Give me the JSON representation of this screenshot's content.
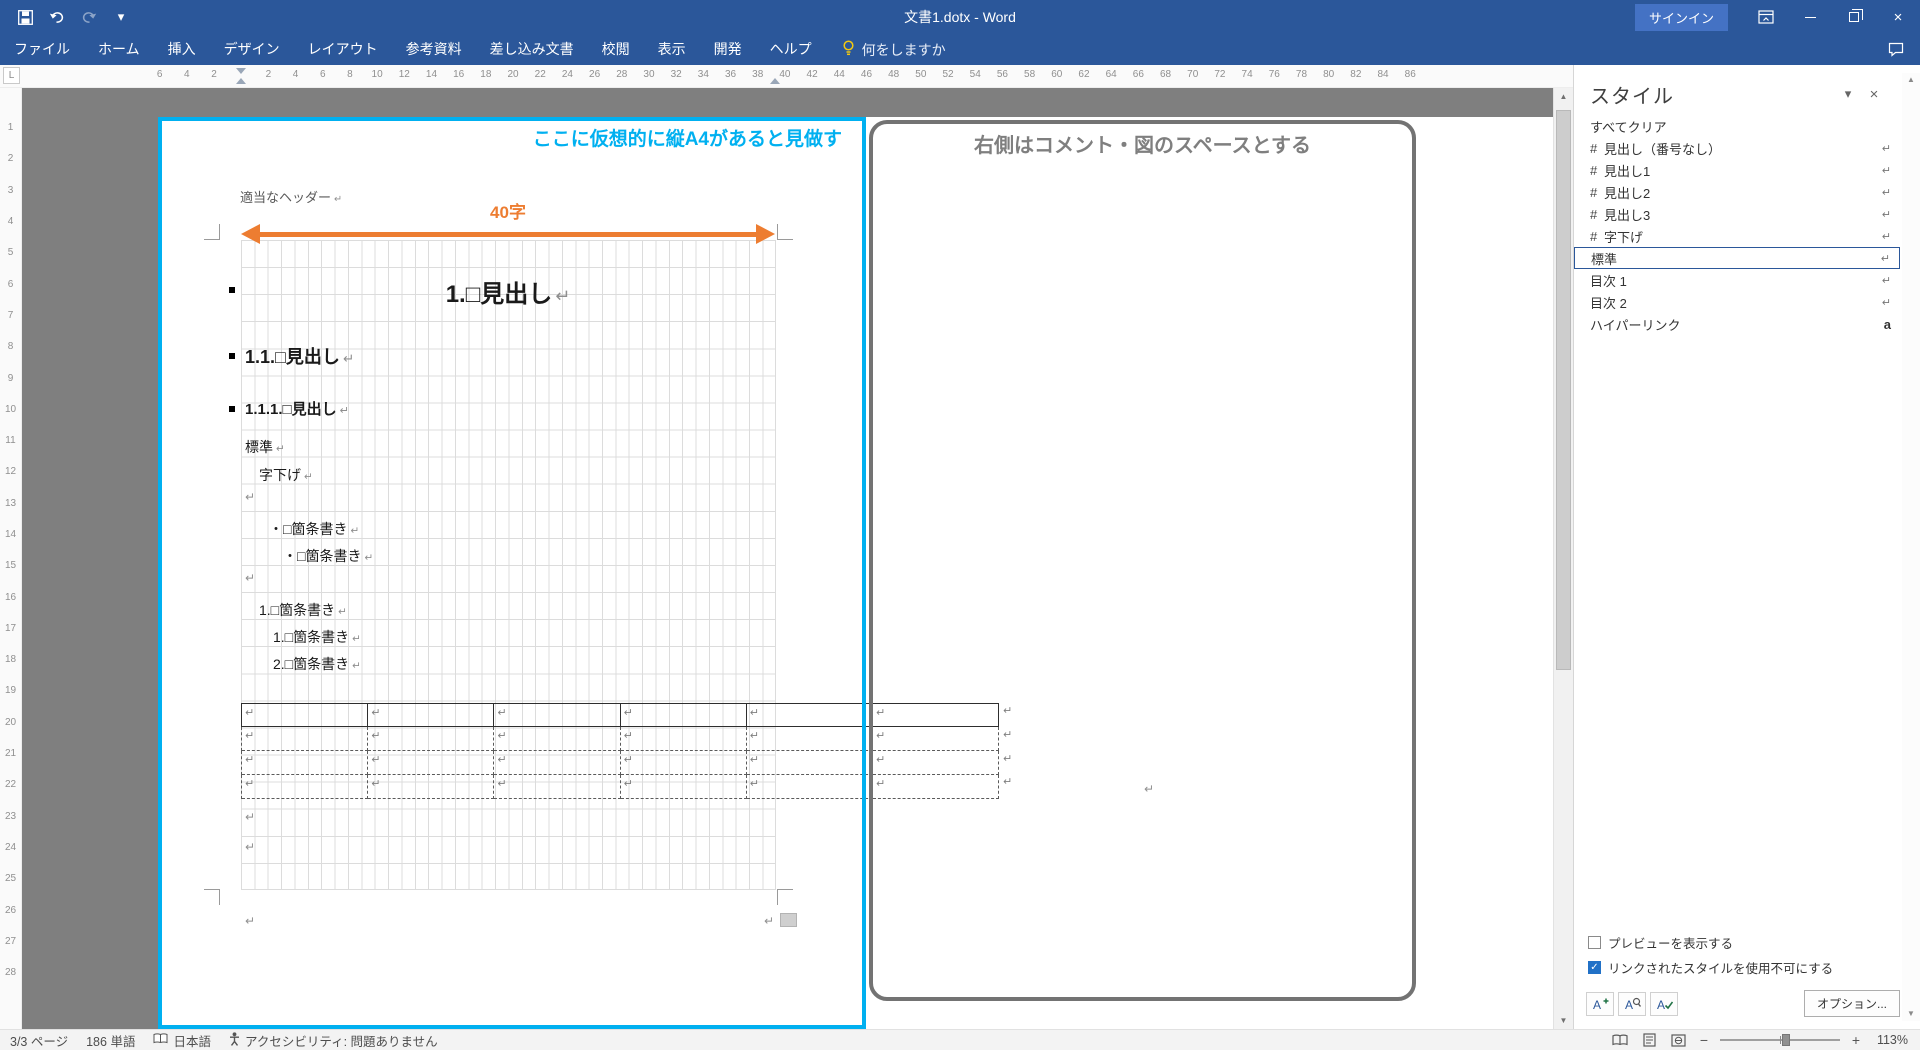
{
  "colors": {
    "titlebar_blue": "#2b579a",
    "virtual_a4_frame_cyan": "#00b0f0",
    "arrow_orange": "#ed7d31",
    "selection_blue": "#2b579a",
    "checkbox_blue": "#2171c7"
  },
  "window": {
    "title": "文書1.dotx - Word",
    "signin": "サインイン"
  },
  "icons": {
    "tab_l": "L",
    "caret": "▾",
    "chevron_down": "▾",
    "close": "×",
    "minimize": "─",
    "scroll_up": "▲",
    "scroll_down": "▼",
    "check": "✓",
    "zoom_minus": "−",
    "zoom_plus": "+"
  },
  "ribbon": {
    "tabs": [
      "ファイル",
      "ホーム",
      "挿入",
      "デザイン",
      "レイアウト",
      "参考資料",
      "差し込み文書",
      "校閲",
      "表示",
      "開発",
      "ヘルプ"
    ],
    "tell_me": "何をしますか"
  },
  "ruler": {
    "h": [
      "6",
      "4",
      "2",
      "",
      "2",
      "4",
      "6",
      "8",
      "10",
      "12",
      "14",
      "16",
      "18",
      "20",
      "22",
      "24",
      "26",
      "28",
      "30",
      "32",
      "34",
      "36",
      "38",
      "40",
      "42",
      "44",
      "46",
      "48",
      "50",
      "52",
      "54",
      "56",
      "58",
      "60",
      "62",
      "64",
      "66",
      "68",
      "70",
      "72",
      "74",
      "76",
      "78",
      "80",
      "82",
      "84",
      "86"
    ],
    "v": [
      "1",
      "2",
      "3",
      "4",
      "5",
      "6",
      "7",
      "8",
      "9",
      "10",
      "11",
      "12",
      "13",
      "14",
      "15",
      "16",
      "17",
      "18",
      "19",
      "20",
      "21",
      "22",
      "23",
      "24",
      "25",
      "26",
      "27",
      "28"
    ]
  },
  "marks": {
    "ret": "↵"
  },
  "doc": {
    "note_left": "ここに仮想的に縦A4があると見做す",
    "note_right": "右側はコメント・図のスペースとする",
    "header": "適当なヘッダー",
    "width_label": "40字",
    "h1": "1.□見出し",
    "h2": "1.1.□見出し",
    "h3": "1.1.1.□見出し",
    "normal": "標準",
    "indent": "字下げ",
    "b1": "・□箇条書き",
    "b2": "・□箇条書き",
    "n1": "1.□箇条書き",
    "n2": "1.□箇条書き",
    "n3": "2.□箇条書き"
  },
  "table": {
    "row_marks": [
      "↵",
      "↵",
      "↵",
      "↵",
      "↵",
      "↵"
    ],
    "out_marks": [
      "↵",
      "↵",
      "↵",
      "↵"
    ]
  },
  "styles": {
    "title": "スタイル",
    "clear_all": "すべてクリア",
    "items": [
      {
        "prefix": "",
        "label": "すべてクリア",
        "marker": ""
      },
      {
        "prefix": "#",
        "label": "見出し（番号なし）",
        "marker": "↵"
      },
      {
        "prefix": "#",
        "label": "見出し1",
        "marker": "↵"
      },
      {
        "prefix": "#",
        "label": "見出し2",
        "marker": "↵"
      },
      {
        "prefix": "#",
        "label": "見出し3",
        "marker": "↵"
      },
      {
        "prefix": "#",
        "label": "字下げ",
        "marker": "↵"
      },
      {
        "prefix": "",
        "label": "標準",
        "marker": "↵"
      },
      {
        "prefix": "",
        "label": "目次 1",
        "marker": "↵"
      },
      {
        "prefix": "",
        "label": "目次 2",
        "marker": "↵"
      },
      {
        "prefix": "",
        "label": "ハイパーリンク",
        "marker": "a"
      }
    ],
    "cb_preview": "プレビューを表示する",
    "cb_disable_linked": "リンクされたスタイルを使用不可にする",
    "options": "オプション..."
  },
  "status": {
    "pages": "3/3 ページ",
    "words": "186 単語",
    "lang": "日本語",
    "a11y": "アクセシビリティ: 問題ありません",
    "zoom": "113%"
  }
}
